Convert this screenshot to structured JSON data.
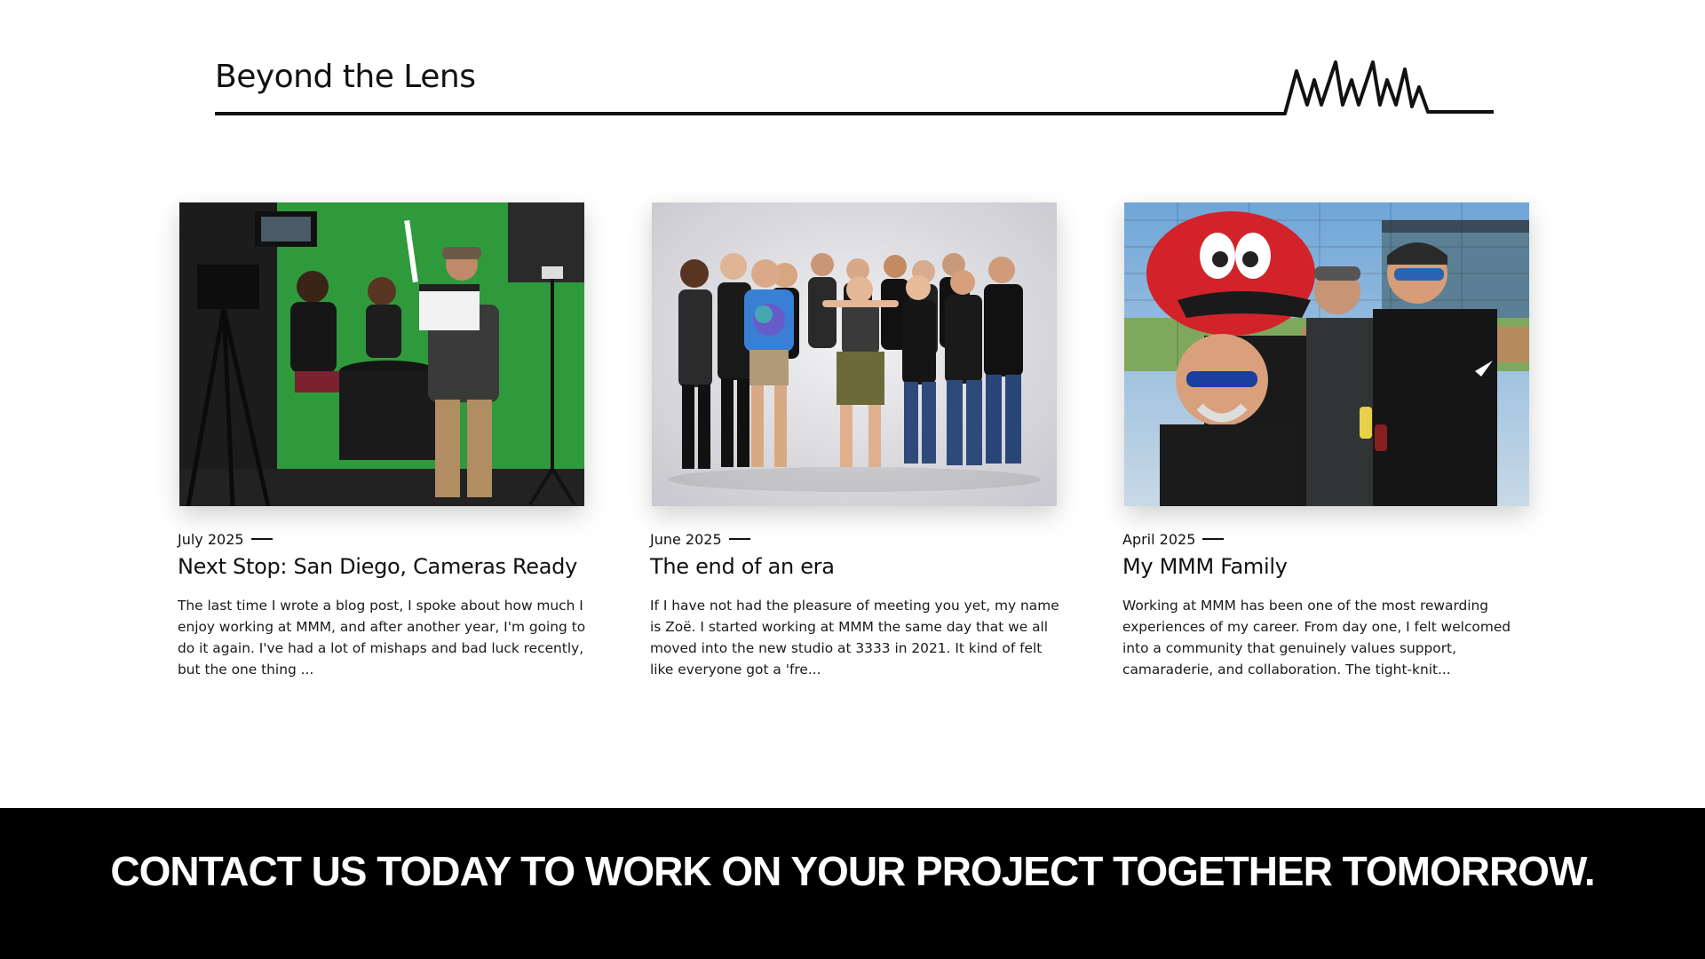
{
  "header": {
    "title": "Beyond the Lens",
    "logo_icon": "mmm-signature-logo"
  },
  "posts": [
    {
      "date": "July 2025",
      "title": "Next Stop: San Diego, Cameras Ready",
      "excerpt": "The last time I wrote a blog post, I spoke about how much I enjoy working at MMM, and after another year, I'm going to do it again. I've had a lot of mishaps and bad luck recently, but the one thing ...",
      "image_icon": "green-screen-photo"
    },
    {
      "date": "June 2025",
      "title": "The end of an era",
      "excerpt": "If I have not had the pleasure of meeting you yet, my name is Zoë. I started working at MMM the same day that we all moved into the new studio at 3333 in 2021. It kind of felt like everyone got a 'fre...",
      "image_icon": "team-group-photo"
    },
    {
      "date": "April 2025",
      "title": "My MMM Family",
      "excerpt": "Working at MMM has been one of the most rewarding experiences of my career. From day one, I felt welcomed into a community that genuinely values support, camaraderie, and collaboration. The tight-knit...",
      "image_icon": "ballpark-mascot-photo"
    }
  ],
  "cta": {
    "text": "CONTACT US TODAY TO WORK ON YOUR PROJECT TOGETHER TOMORROW."
  },
  "colors": {
    "text": "#111111",
    "cta_background": "#000000",
    "cta_text": "#ffffff",
    "green_screen": "#2f9a3c"
  }
}
